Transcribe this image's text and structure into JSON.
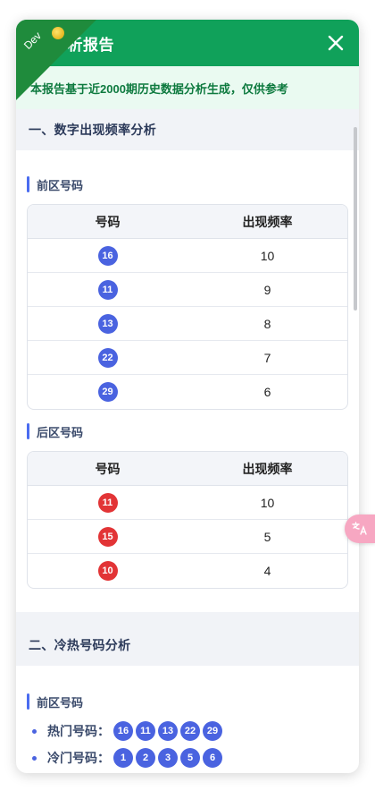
{
  "header": {
    "title": "分析报告",
    "dev_label": "Dev",
    "close_icon": "close-icon"
  },
  "notice": "本报告基于近2000期历史数据分析生成，仅供参考",
  "section1": {
    "title": "一、数字出现频率分析",
    "front": {
      "title": "前区号码",
      "col_number": "号码",
      "col_freq": "出现频率",
      "rows": [
        {
          "number": "16",
          "freq": "10"
        },
        {
          "number": "11",
          "freq": "9"
        },
        {
          "number": "13",
          "freq": "8"
        },
        {
          "number": "22",
          "freq": "7"
        },
        {
          "number": "29",
          "freq": "6"
        }
      ]
    },
    "back": {
      "title": "后区号码",
      "col_number": "号码",
      "col_freq": "出现频率",
      "rows": [
        {
          "number": "11",
          "freq": "10"
        },
        {
          "number": "15",
          "freq": "5"
        },
        {
          "number": "10",
          "freq": "4"
        }
      ]
    }
  },
  "section2": {
    "title": "二、冷热号码分析",
    "front": {
      "title": "前区号码",
      "hot_label": "热门号码：",
      "hot": [
        "16",
        "11",
        "13",
        "22",
        "29"
      ],
      "cold_label": "冷门号码：",
      "cold": [
        "1",
        "2",
        "3",
        "5",
        "6"
      ]
    }
  },
  "colors": {
    "header_green": "#10a15a",
    "ball_blue": "#4a63e0",
    "ball_red": "#e23436",
    "accent_bar": "#4a6cf0"
  }
}
